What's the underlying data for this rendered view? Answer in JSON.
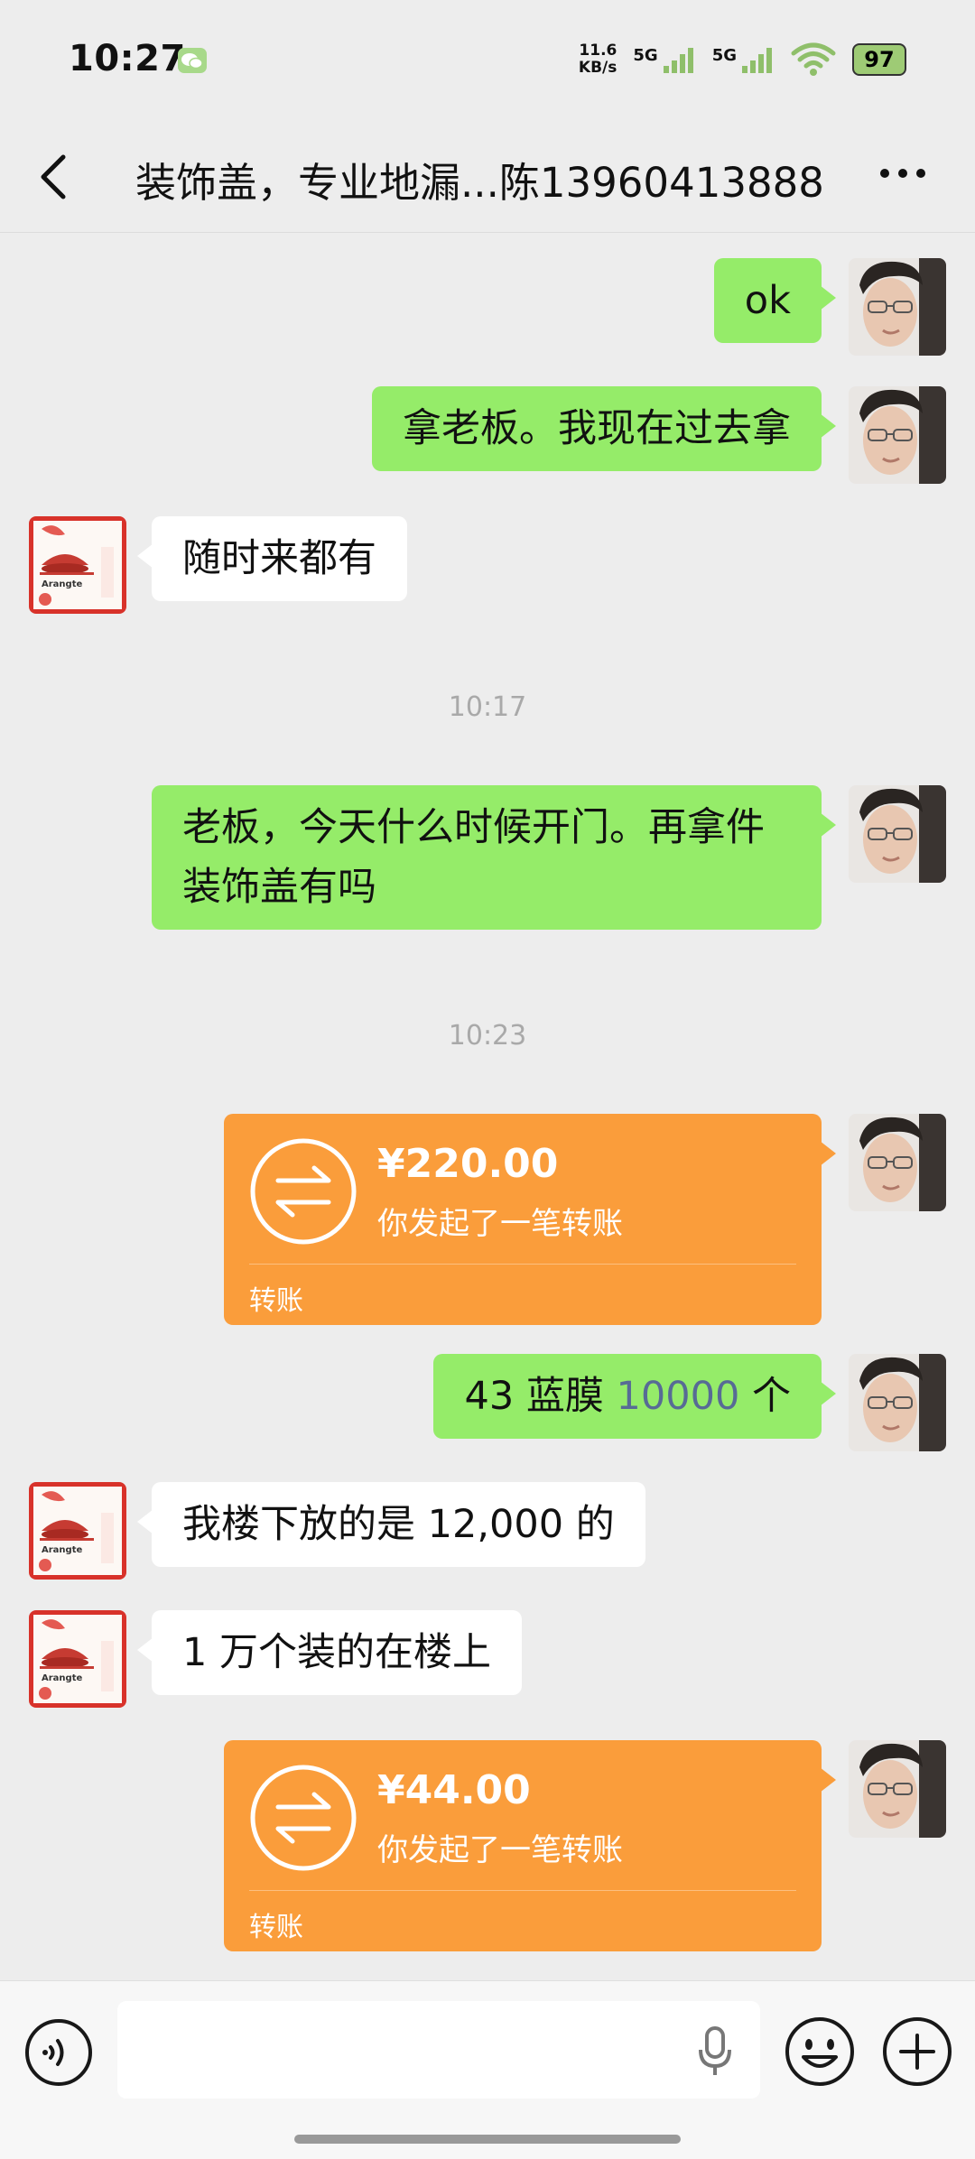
{
  "status_bar": {
    "time": "10:27",
    "net_speed_value": "11.6",
    "net_speed_unit": "KB/s",
    "signal1_label": "5G",
    "signal2_label": "5G",
    "battery": "97"
  },
  "header": {
    "title": "装饰盖，专业地漏...陈13960413888"
  },
  "messages": [
    {
      "side": "me",
      "text": "ok"
    },
    {
      "side": "me",
      "text": "拿老板。我现在过去拿"
    },
    {
      "side": "them",
      "text": "随时来都有"
    },
    {
      "timestamp": "10:17"
    },
    {
      "side": "me",
      "text": "老板，今天什么时候开门。再拿件装饰盖有吗"
    },
    {
      "timestamp": "10:23"
    },
    {
      "side": "me",
      "type": "transfer",
      "amount": "¥220.00",
      "desc": "你发起了一笔转账",
      "label": "转账"
    },
    {
      "side": "me",
      "text_before": "43 蓝膜 ",
      "link": "10000",
      "text_after": " 个"
    },
    {
      "side": "them",
      "text": "我楼下放的是 12,000 的"
    },
    {
      "side": "them",
      "text": "1 万个装的在楼上"
    },
    {
      "side": "me",
      "type": "transfer",
      "amount": "¥44.00",
      "desc": "你发起了一笔转账",
      "label": "转账"
    }
  ],
  "input": {
    "placeholder": ""
  },
  "colors": {
    "my_bubble": "#95ec69",
    "their_bubble": "#ffffff",
    "transfer": "#fa9d3b",
    "background": "#ededed",
    "link": "#576b95"
  }
}
